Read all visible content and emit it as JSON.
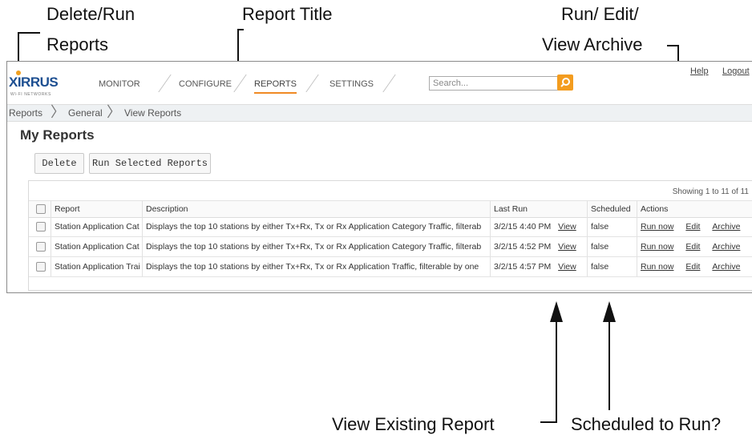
{
  "annotations": {
    "delete_run": [
      "Delete/Run",
      "Reports"
    ],
    "report_title": "Report Title",
    "run_edit_view": [
      "Run/ Edit/",
      "View Archive"
    ],
    "view_existing": "View Existing Report",
    "scheduled": "Scheduled to Run?"
  },
  "app": {
    "logo": "XIRRUS",
    "logo_sub": "WI-FI NETWORKS",
    "nav": [
      "MONITOR",
      "CONFIGURE",
      "REPORTS",
      "SETTINGS"
    ],
    "active_nav": "REPORTS",
    "search_placeholder": "Search...",
    "help": "Help",
    "logout": "Logout"
  },
  "breadcrumb": [
    "Reports",
    "General",
    "View Reports"
  ],
  "page_title": "My Reports",
  "buttons": {
    "delete": "Delete",
    "run_selected": "Run Selected Reports"
  },
  "table": {
    "showing": "Showing 1 to 11 of 11",
    "columns": [
      "Report",
      "Description",
      "Last Run",
      "Scheduled",
      "Actions"
    ],
    "rows": [
      {
        "report": "Station Application Cat",
        "description": "Displays the top 10 stations by either Tx+Rx, Tx or Rx Application Category Traffic, filterab",
        "last_run": "3/2/15 4:40 PM",
        "view": "View",
        "scheduled": "false",
        "run_now": "Run now",
        "edit": "Edit",
        "archive": "Archive"
      },
      {
        "report": "Station Application Cat",
        "description": "Displays the top 10 stations by either Tx+Rx, Tx or Rx Application Category Traffic, filterab",
        "last_run": "3/2/15 4:52 PM",
        "view": "View",
        "scheduled": "false",
        "run_now": "Run now",
        "edit": "Edit",
        "archive": "Archive"
      },
      {
        "report": "Station Application Trai",
        "description": "Displays the top 10 stations by either Tx+Rx, Tx or Rx Application Traffic, filterable by one",
        "last_run": "3/2/15 4:57 PM",
        "view": "View",
        "scheduled": "false",
        "run_now": "Run now",
        "edit": "Edit",
        "archive": "Archive"
      }
    ]
  }
}
